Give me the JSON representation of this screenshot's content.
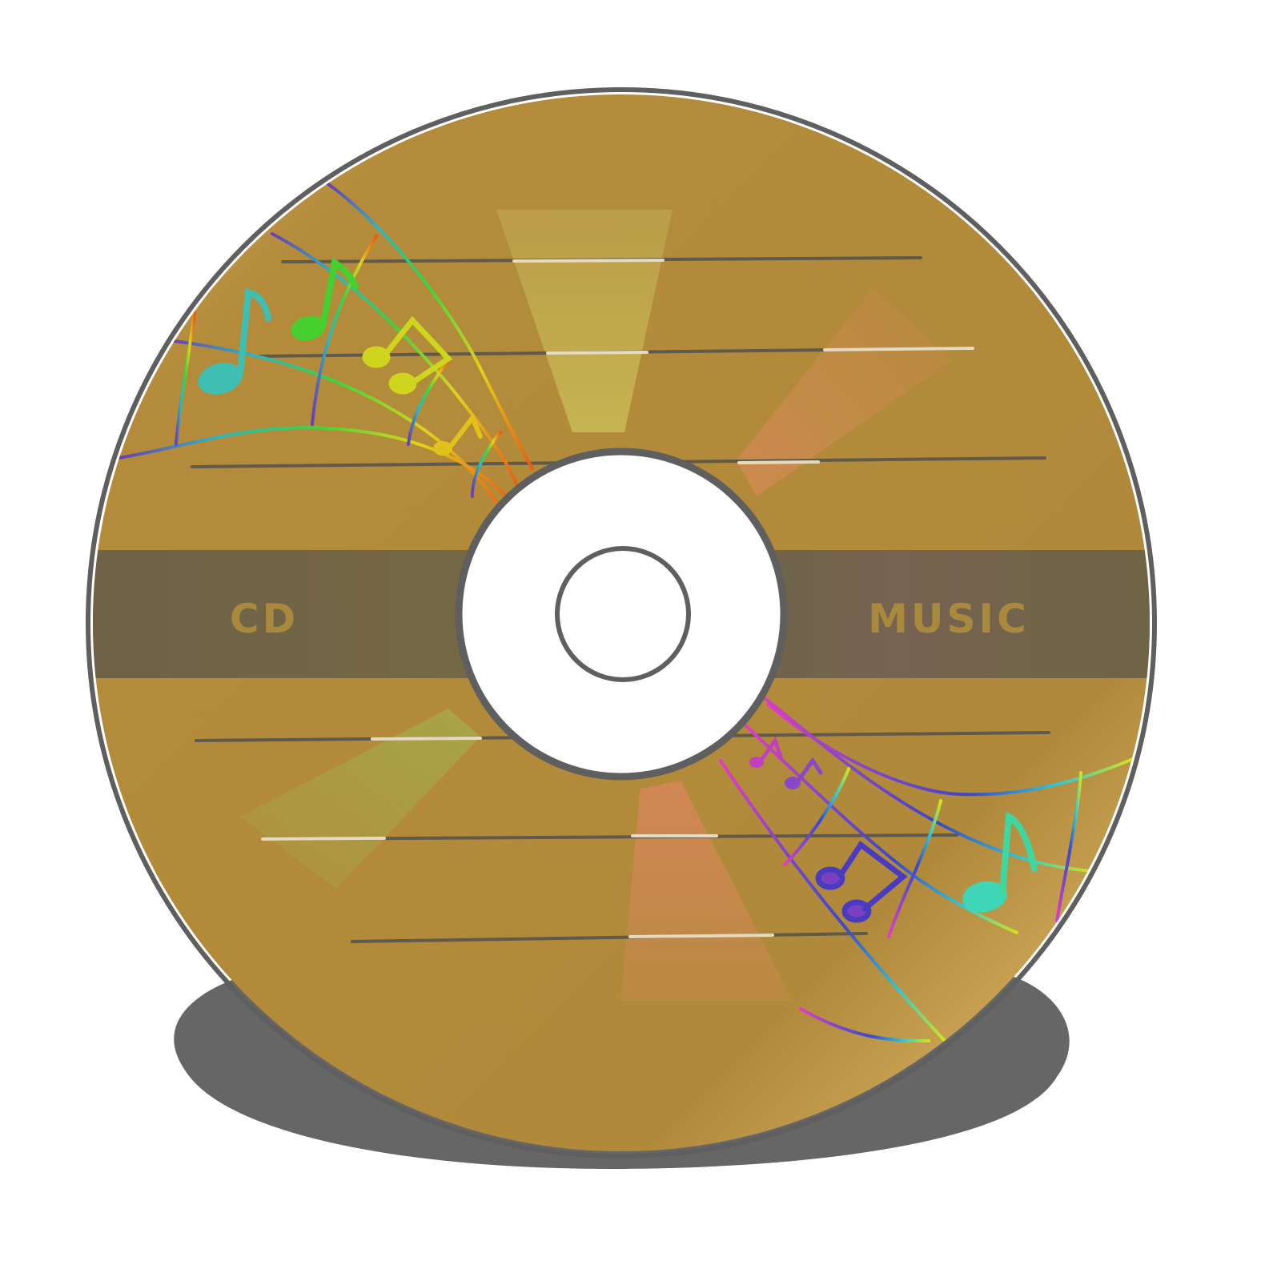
{
  "disc": {
    "left_label": "CD",
    "right_label": "MUSIC"
  },
  "colors": {
    "disc_base": "#b08a3a",
    "disc_highlight": "#dbb266",
    "label_band": "#736645",
    "label_text": "#a8893e",
    "outline": "#5f5f5f",
    "shadow": "#666666",
    "hub": "#ffffff"
  },
  "icons": [
    "music-note-icon",
    "music-staff-icon"
  ]
}
